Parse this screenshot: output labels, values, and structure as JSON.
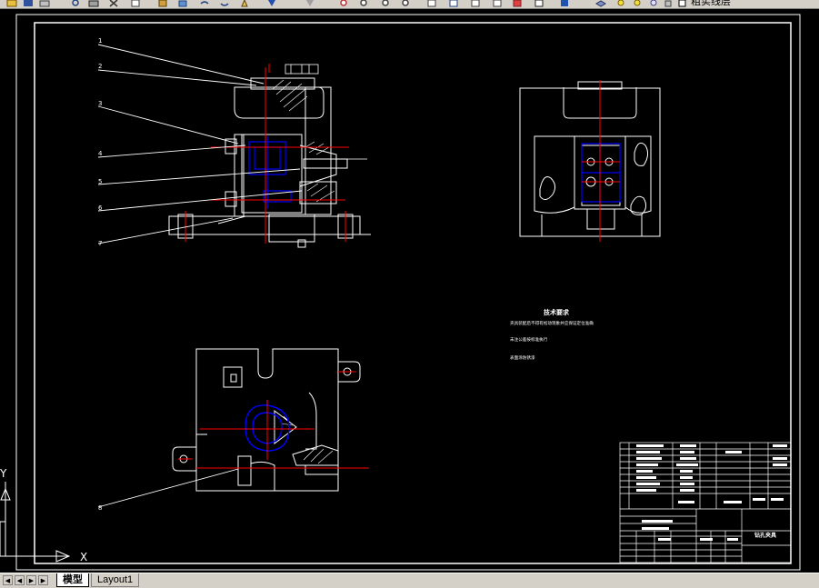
{
  "toolbar": {
    "icons": [
      "open-icon",
      "save-icon",
      "print-icon",
      "preview-icon",
      "plot-icon",
      "cut-icon",
      "copy-icon",
      "paste-icon",
      "matchprop-icon",
      "undo-icon",
      "redo-icon",
      "pan-icon",
      "zoom-realtime-icon",
      "zoom-window-icon",
      "zoom-previous-icon",
      "properties-icon",
      "designcenter-icon",
      "toolpalette-icon",
      "calculator-icon",
      "help-icon",
      "layer-icon",
      "layer-state-icon"
    ],
    "layer_name": "粗实线层"
  },
  "drawing": {
    "part_callouts": [
      "1",
      "2",
      "3",
      "4",
      "5",
      "6",
      "7",
      "8"
    ],
    "tech_req_title": "技术要求",
    "tech_req_lines": [
      "夹具装配后不得有松动现象并应保证定位准确",
      "未注公差按标准执行",
      "表面涂防锈漆"
    ],
    "title_block_name": "钻孔夹具",
    "ucs_x_label": "X",
    "ucs_y_label": "Y"
  },
  "tabs": {
    "model": "模型",
    "layout1": "Layout1"
  },
  "colors": {
    "background": "#000000",
    "lines": "#ffffff",
    "centerlines": "#ff0000",
    "hidden": "#0000ff",
    "ui_gray": "#d4d0c8"
  }
}
